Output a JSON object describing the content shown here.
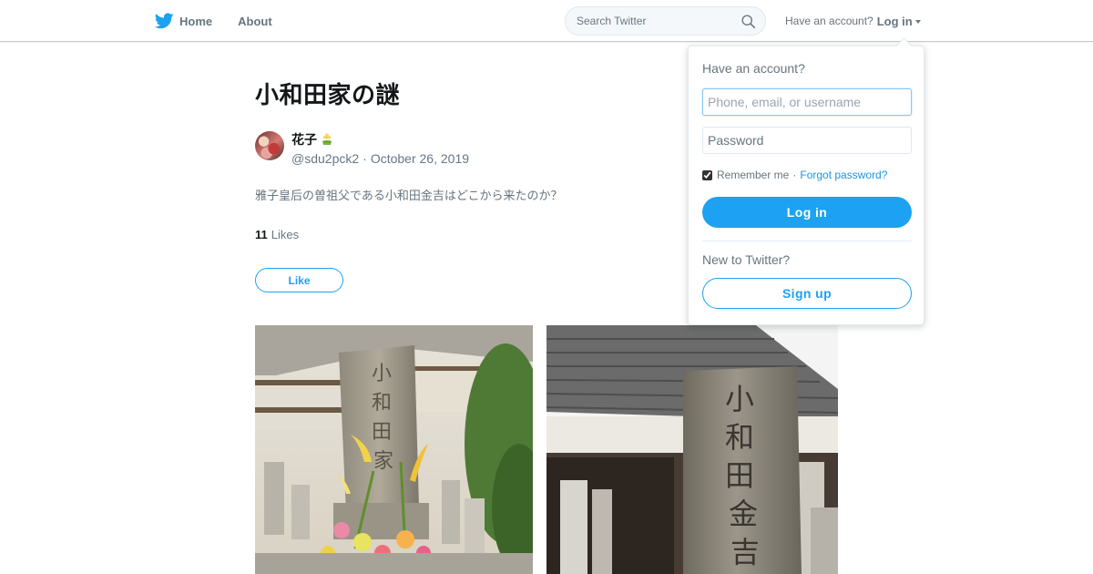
{
  "nav": {
    "home_label": "Home",
    "about_label": "About",
    "search_placeholder": "Search Twitter",
    "have_account_text": "Have an account?",
    "login_label": "Log in"
  },
  "tweet": {
    "title": "小和田家の謎",
    "author_name": "花子",
    "author_emoji": "flower-emoji",
    "handle": "@sdu2pck2",
    "separator": "·",
    "date": "October 26, 2019",
    "text": "雅子皇后の曽祖父である小和田金吉はどこから来たのか？",
    "likes_count": "11",
    "likes_label": "Likes",
    "like_button_label": "Like"
  },
  "photos": [
    {
      "icon": "gravestone-photo-with-flowers"
    },
    {
      "icon": "gravestone-photo-with-roof"
    }
  ],
  "login_dropdown": {
    "heading": "Have an account?",
    "username_placeholder": "Phone, email, or username",
    "password_placeholder": "Password",
    "remember_label": "Remember me",
    "remember_checked": true,
    "separator": "·",
    "forgot_label": "Forgot password?",
    "login_button": "Log in",
    "new_heading": "New to Twitter?",
    "signup_button": "Sign up"
  },
  "colors": {
    "accent": "#1da1f2",
    "text_primary": "#14171a",
    "text_secondary": "#657786",
    "link": "#1b95e0"
  }
}
